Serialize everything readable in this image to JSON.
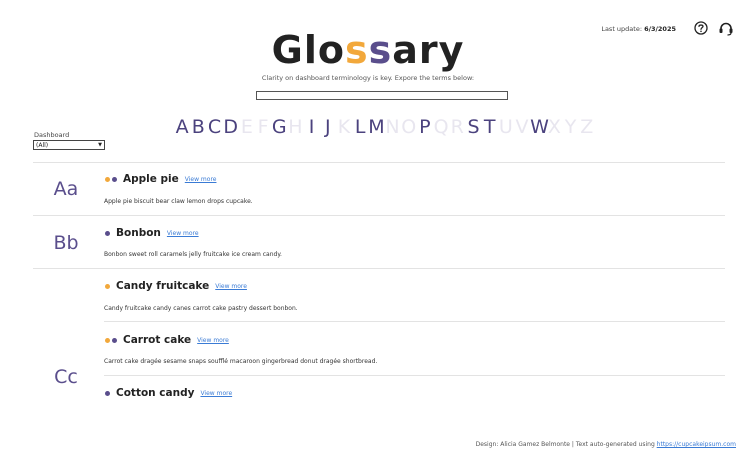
{
  "header": {
    "title_parts": {
      "a": "Glo",
      "b": "s",
      "c": "s",
      "d": "ary"
    },
    "subtitle": "Clarity on dashboard terminology is key. Expore the terms below:",
    "last_update_label": "Last update:",
    "last_update_value": "6/3/2025",
    "search_value": ""
  },
  "icons": {
    "help": "question-circle-icon",
    "support": "headset-icon"
  },
  "filter": {
    "label": "Dashboard",
    "selected": "(All)"
  },
  "alphabet": [
    {
      "letter": "A",
      "active": true
    },
    {
      "letter": "B",
      "active": true
    },
    {
      "letter": "C",
      "active": true
    },
    {
      "letter": "D",
      "active": true
    },
    {
      "letter": "E",
      "active": false
    },
    {
      "letter": "F",
      "active": false
    },
    {
      "letter": "G",
      "active": true
    },
    {
      "letter": "H",
      "active": false
    },
    {
      "letter": "I",
      "active": true
    },
    {
      "letter": "J",
      "active": true
    },
    {
      "letter": "K",
      "active": false
    },
    {
      "letter": "L",
      "active": true
    },
    {
      "letter": "M",
      "active": true
    },
    {
      "letter": "N",
      "active": false
    },
    {
      "letter": "O",
      "active": false
    },
    {
      "letter": "P",
      "active": true
    },
    {
      "letter": "Q",
      "active": false
    },
    {
      "letter": "R",
      "active": false
    },
    {
      "letter": "S",
      "active": true
    },
    {
      "letter": "T",
      "active": true
    },
    {
      "letter": "U",
      "active": false
    },
    {
      "letter": "V",
      "active": false
    },
    {
      "letter": "W",
      "active": true
    },
    {
      "letter": "X",
      "active": false
    },
    {
      "letter": "Y",
      "active": false
    },
    {
      "letter": "Z",
      "active": false
    }
  ],
  "sections": [
    {
      "label": "Aa"
    },
    {
      "label": "Bb"
    },
    {
      "label": "Cc"
    }
  ],
  "terms": [
    {
      "name": "Apple pie",
      "link": "View more",
      "desc": "Apple pie biscuit bear claw lemon drops cupcake.",
      "dots": [
        "#f2a83b",
        "#5a4e8c"
      ]
    },
    {
      "name": "Bonbon",
      "link": "View more",
      "desc": "Bonbon sweet roll caramels jelly fruitcake ice cream candy.",
      "dots": [
        "#5a4e8c"
      ]
    },
    {
      "name": "Candy fruitcake",
      "link": "View more",
      "desc": "Candy fruitcake candy canes carrot cake pastry dessert bonbon.",
      "dots": [
        "#f2a83b"
      ]
    },
    {
      "name": "Carrot cake",
      "link": "View more",
      "desc": "Carrot cake dragée sesame snaps soufflé macaroon gingerbread donut dragée shortbread.",
      "dots": [
        "#f2a83b",
        "#5a4e8c"
      ]
    },
    {
      "name": "Cotton candy",
      "link": "View more",
      "desc": "",
      "dots": [
        "#5a4e8c"
      ]
    }
  ],
  "footer": {
    "text": "Design: Alicia Gamez Belmonte | Text auto-generated using ",
    "link": "https://cupcakeipsum.com"
  },
  "colors": {
    "orange": "#f2a83b",
    "purple": "#5a4e8c",
    "inactive_letter": "#e8e6ef"
  }
}
